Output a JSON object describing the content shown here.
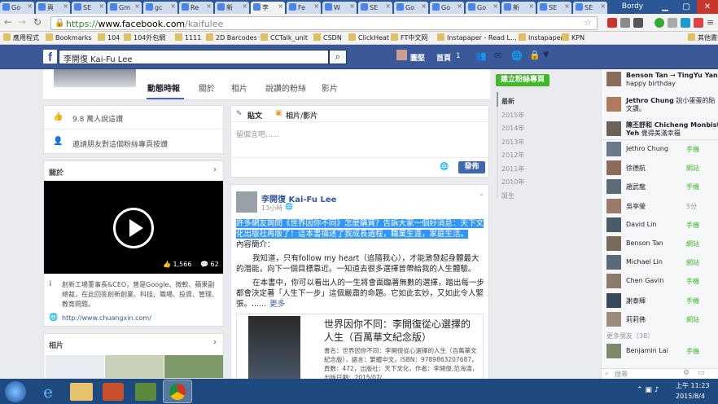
{
  "browser": {
    "tabs": [
      "Go",
      "頁",
      "SE",
      "Gm",
      "gc",
      "Re",
      "新",
      "李",
      "Fe",
      "W",
      "SE",
      "Go",
      "Go",
      "Go",
      "新",
      "SE",
      "SE"
    ],
    "active_tab": 7,
    "user": "Bordy",
    "url_prefix": "https://",
    "url_host": "www.facebook.com",
    "url_path": "/kaifulee",
    "bookmarks": [
      "應用程式",
      "Bookmarks",
      "104",
      "104外包網",
      "1111",
      "2D Barcodes",
      "CCTalk_unit",
      "CSDN",
      "ClickHeat",
      "FT中文网",
      "Instapaper - Read L...",
      "Instapaper",
      "KPN",
      "其他書籤"
    ]
  },
  "fb": {
    "search_value": "李開復 Kai-Fu Lee",
    "nav_user": "圖堅",
    "nav_home": "首頁",
    "nav_home_count": "1",
    "page_tabs": [
      "動態時報",
      "關於",
      "相片",
      "說讚的粉絲",
      "影片"
    ],
    "likes": "9.8 萬人說這讚",
    "invite": "邀請朋友對這個粉絲專頁按讚",
    "about_title": "關於",
    "video_likes": "1,566",
    "video_comments": "62",
    "about_text": "創新工場董事長&CEO，曾是Google、微軟、蘋果副總裁，在此回答創新創業、科技、職場、投資、管理、教育問題。",
    "about_url": "http://www.chuangxin.com/",
    "photos_title": "相片",
    "composer_status": "貼文",
    "composer_photo": "相片/影片",
    "composer_placeholder": "留個言吧......",
    "publish": "發佈",
    "post_author": "李開復 Kai-Fu Lee",
    "post_time": "13小時",
    "post_highlight": "許多網友詢問《世界因你不同》怎麼購買？告訴大家一個好消息：天下文化出版社再版了！這本書描述了我成長過程，職業生涯，家庭生活。",
    "post_intro": "內容簡介：",
    "post_p1": "我知道，只有follow my heart（追隨我心），才能激發起身體最大的潛能，向下一個目標靠近。一知道去很多選擇曾帶給我的人生體驗。",
    "post_p2": "在本書中，你可以看出人的一生將會面臨著無數的選擇，踏出每一步都會決定著「人生下一步」這個嚴肅的命題。它如此玄妙，又如此令人緊張。......",
    "more": "更多",
    "book_title": "世界因你不同：李開復從心選擇的人生（百萬華文紀念版）",
    "book_detail": "書名：世界因你不同：李開復從心選擇的人生（百萬華文紀念版），語言：繁體中文，ISBN：9789863207687，頁數：472，出版社：天下文化，作者：李開復,范海濤，出版日期：2015/07/...",
    "create_page": "建立粉絲專頁",
    "timeline_years": [
      "最新",
      "2015年",
      "2014年",
      "2013年",
      "2012年",
      "2011年",
      "2010年",
      "誕生"
    ]
  },
  "chat": {
    "feed": [
      {
        "name": "Benson Tan",
        "arrow": "→",
        "to": "TingYu Yan",
        "text": "happy birthday"
      },
      {
        "name": "Jethro Chung",
        "text": "說小蛋蛋的貼文讚。"
      },
      {
        "name": "陳丕舒和 Chicheng Monbist Yeh",
        "text": "覺得美滿幸福"
      }
    ],
    "friends": [
      {
        "name": "Jethro Chung",
        "status": "手機"
      },
      {
        "name": "徐德航",
        "status": "網站"
      },
      {
        "name": "趙武龍",
        "status": "手機"
      },
      {
        "name": "吳亭瑩",
        "status": "5分"
      },
      {
        "name": "David Lin",
        "status": "手機"
      },
      {
        "name": "Benson Tan",
        "status": "網站"
      },
      {
        "name": "Michael Lin",
        "status": "網站"
      },
      {
        "name": "Chen Gavin",
        "status": "手機"
      },
      {
        "name": "謝泰輝",
        "status": "手機"
      },
      {
        "name": "莉莉佛",
        "status": "網站"
      }
    ],
    "more_friends": "更多朋友（38）",
    "more_friend": {
      "name": "Benjamin Lai",
      "status": "手機"
    },
    "search_placeholder": "搜尋"
  },
  "taskbar": {
    "time": "上午 11:23",
    "date": "2015/8/4"
  }
}
